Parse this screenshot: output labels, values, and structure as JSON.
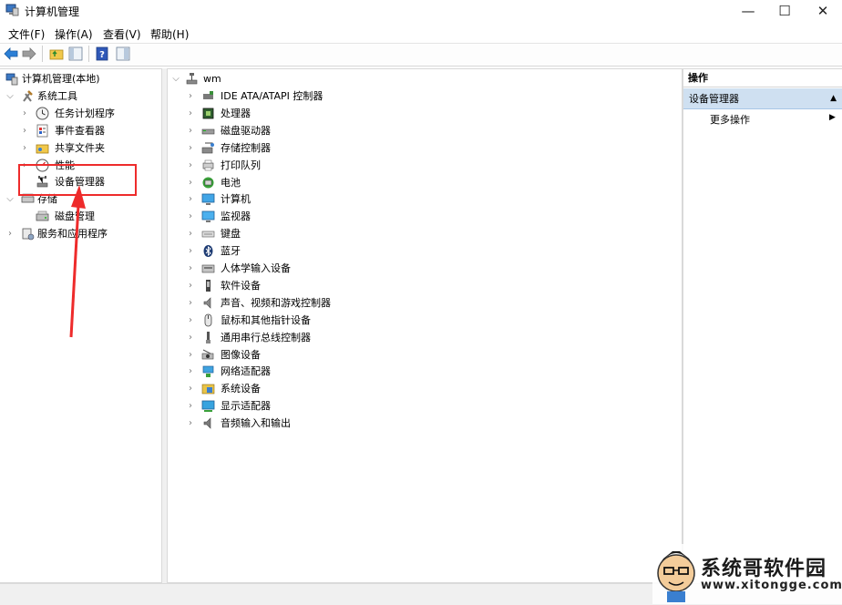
{
  "window": {
    "title": "计算机管理",
    "controls": {
      "minimize": "—",
      "maximize": "☐",
      "close": "✕"
    }
  },
  "menu": [
    "文件(F)",
    "操作(A)",
    "查看(V)",
    "帮助(H)"
  ],
  "toolbar": [
    "back-icon",
    "forward-icon",
    "up-folder-icon",
    "show-tree-icon",
    "help-icon",
    "properties-icon"
  ],
  "tree": {
    "root": "计算机管理(本地)",
    "system_tools": "系统工具",
    "system_children": [
      "任务计划程序",
      "事件查看器",
      "共享文件夹",
      "性能",
      "设备管理器"
    ],
    "storage": "存储",
    "storage_children": [
      "磁盘管理"
    ],
    "services": "服务和应用程序"
  },
  "devices": {
    "computer_name": "wm",
    "categories": [
      "IDE ATA/ATAPI 控制器",
      "处理器",
      "磁盘驱动器",
      "存储控制器",
      "打印队列",
      "电池",
      "计算机",
      "监视器",
      "键盘",
      "蓝牙",
      "人体学输入设备",
      "软件设备",
      "声音、视频和游戏控制器",
      "鼠标和其他指针设备",
      "通用串行总线控制器",
      "图像设备",
      "网络适配器",
      "系统设备",
      "显示适配器",
      "音频输入和输出"
    ]
  },
  "actions": {
    "header": "操作",
    "section": "设备管理器",
    "more": "更多操作"
  },
  "watermark": {
    "title": "系统哥软件园",
    "url": "www.xitongge.com"
  },
  "colors": {
    "highlight": "#ee2b2b",
    "selected_section": "#cfe0f1",
    "accent_blue": "#1f6fc5"
  }
}
